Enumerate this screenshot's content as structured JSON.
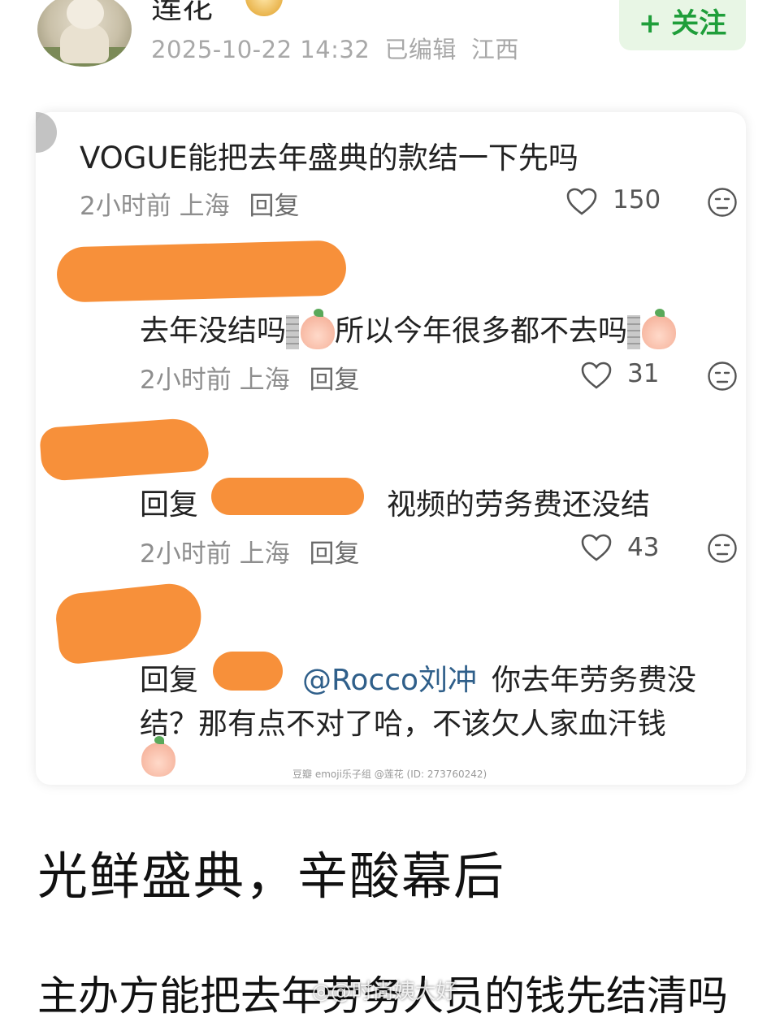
{
  "header": {
    "author_name": "莲花",
    "meta_date": "2025-10-22 14:32",
    "meta_edited": "已编辑",
    "meta_location": "江西",
    "follow_label": "+ 关注"
  },
  "comments": [
    {
      "text": "VOGUE能把去年盛典的款结一下先吗",
      "time": "2小时前",
      "location": "上海",
      "reply_label": "回复",
      "likes": "150"
    },
    {
      "text_a": "去年没结吗",
      "text_b": "所以今年很多都不去吗",
      "time": "2小时前",
      "location": "上海",
      "reply_label": "回复",
      "likes": "31"
    },
    {
      "prefix": "回复",
      "text": "视频的劳务费还没结",
      "time": "2小时前",
      "location": "上海",
      "reply_label": "回复",
      "likes": "43"
    },
    {
      "prefix": "回复",
      "mention": "@Rocco刘冲",
      "text_line1": "你去年劳务费没",
      "text_line2": "结？那有点不对了哈，不该欠人家血汗钱"
    }
  ],
  "screenshot_watermark": "豆瓣  emoji乐子组 @莲花 (ID: 273760242)",
  "headline": "光鲜盛典，辛酸幕后",
  "body": "主办方能把去年劳务人员的钱先结清吗",
  "weibo_watermark": "◎@时尚姨大好"
}
